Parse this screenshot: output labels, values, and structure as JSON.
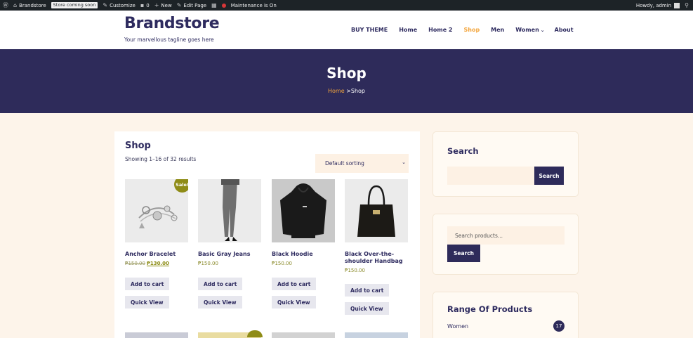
{
  "admin_bar": {
    "site_name": "Brandstore",
    "store_badge": "Store coming soon",
    "customize": "Customize",
    "comments_count": "0",
    "new_label": "New",
    "edit_page": "Edit Page",
    "maintenance": "Maintenance is On",
    "howdy": "Howdy, admin"
  },
  "header": {
    "brand": "Brandstore",
    "tagline": "Your marvellous tagline goes here",
    "nav": [
      {
        "label": "BUY THEME"
      },
      {
        "label": "Home"
      },
      {
        "label": "Home 2"
      },
      {
        "label": "Shop"
      },
      {
        "label": "Men"
      },
      {
        "label": "Women"
      },
      {
        "label": "About"
      }
    ]
  },
  "banner": {
    "title": "Shop",
    "crumb_home": "Home",
    "crumb_sep": ">",
    "crumb_current": "Shop"
  },
  "shop": {
    "heading": "Shop",
    "results": "Showing 1–16 of 32 results",
    "sort_value": "Default sorting",
    "products": [
      {
        "name": "Anchor Bracelet",
        "old_price": "₱150.00",
        "price": "₱130.00",
        "badge": "Sale!",
        "add_label": "Add to cart",
        "view_label": "Quick View"
      },
      {
        "name": "Basic Gray Jeans",
        "price": "₱150.00",
        "add_label": "Add to cart",
        "view_label": "Quick View"
      },
      {
        "name": "Black Hoodie",
        "price": "₱150.00",
        "add_label": "Add to cart",
        "view_label": "Quick View"
      },
      {
        "name": "Black Over-the-shoulder Handbag",
        "price": "₱150.00",
        "add_label": "Add to cart",
        "view_label": "Quick View"
      }
    ]
  },
  "sidebar": {
    "search_widget": {
      "title": "Search",
      "button": "Search"
    },
    "product_search": {
      "placeholder": "Search products...",
      "button": "Search"
    },
    "range": {
      "title": "Range Of Products",
      "items": [
        {
          "label": "Women",
          "count": "17"
        }
      ]
    }
  },
  "colors": {
    "brand_navy": "#2e2b5a",
    "accent_orange": "#f3a53c",
    "sale_olive": "#8f8c17",
    "page_bg": "#fdf4ea"
  }
}
